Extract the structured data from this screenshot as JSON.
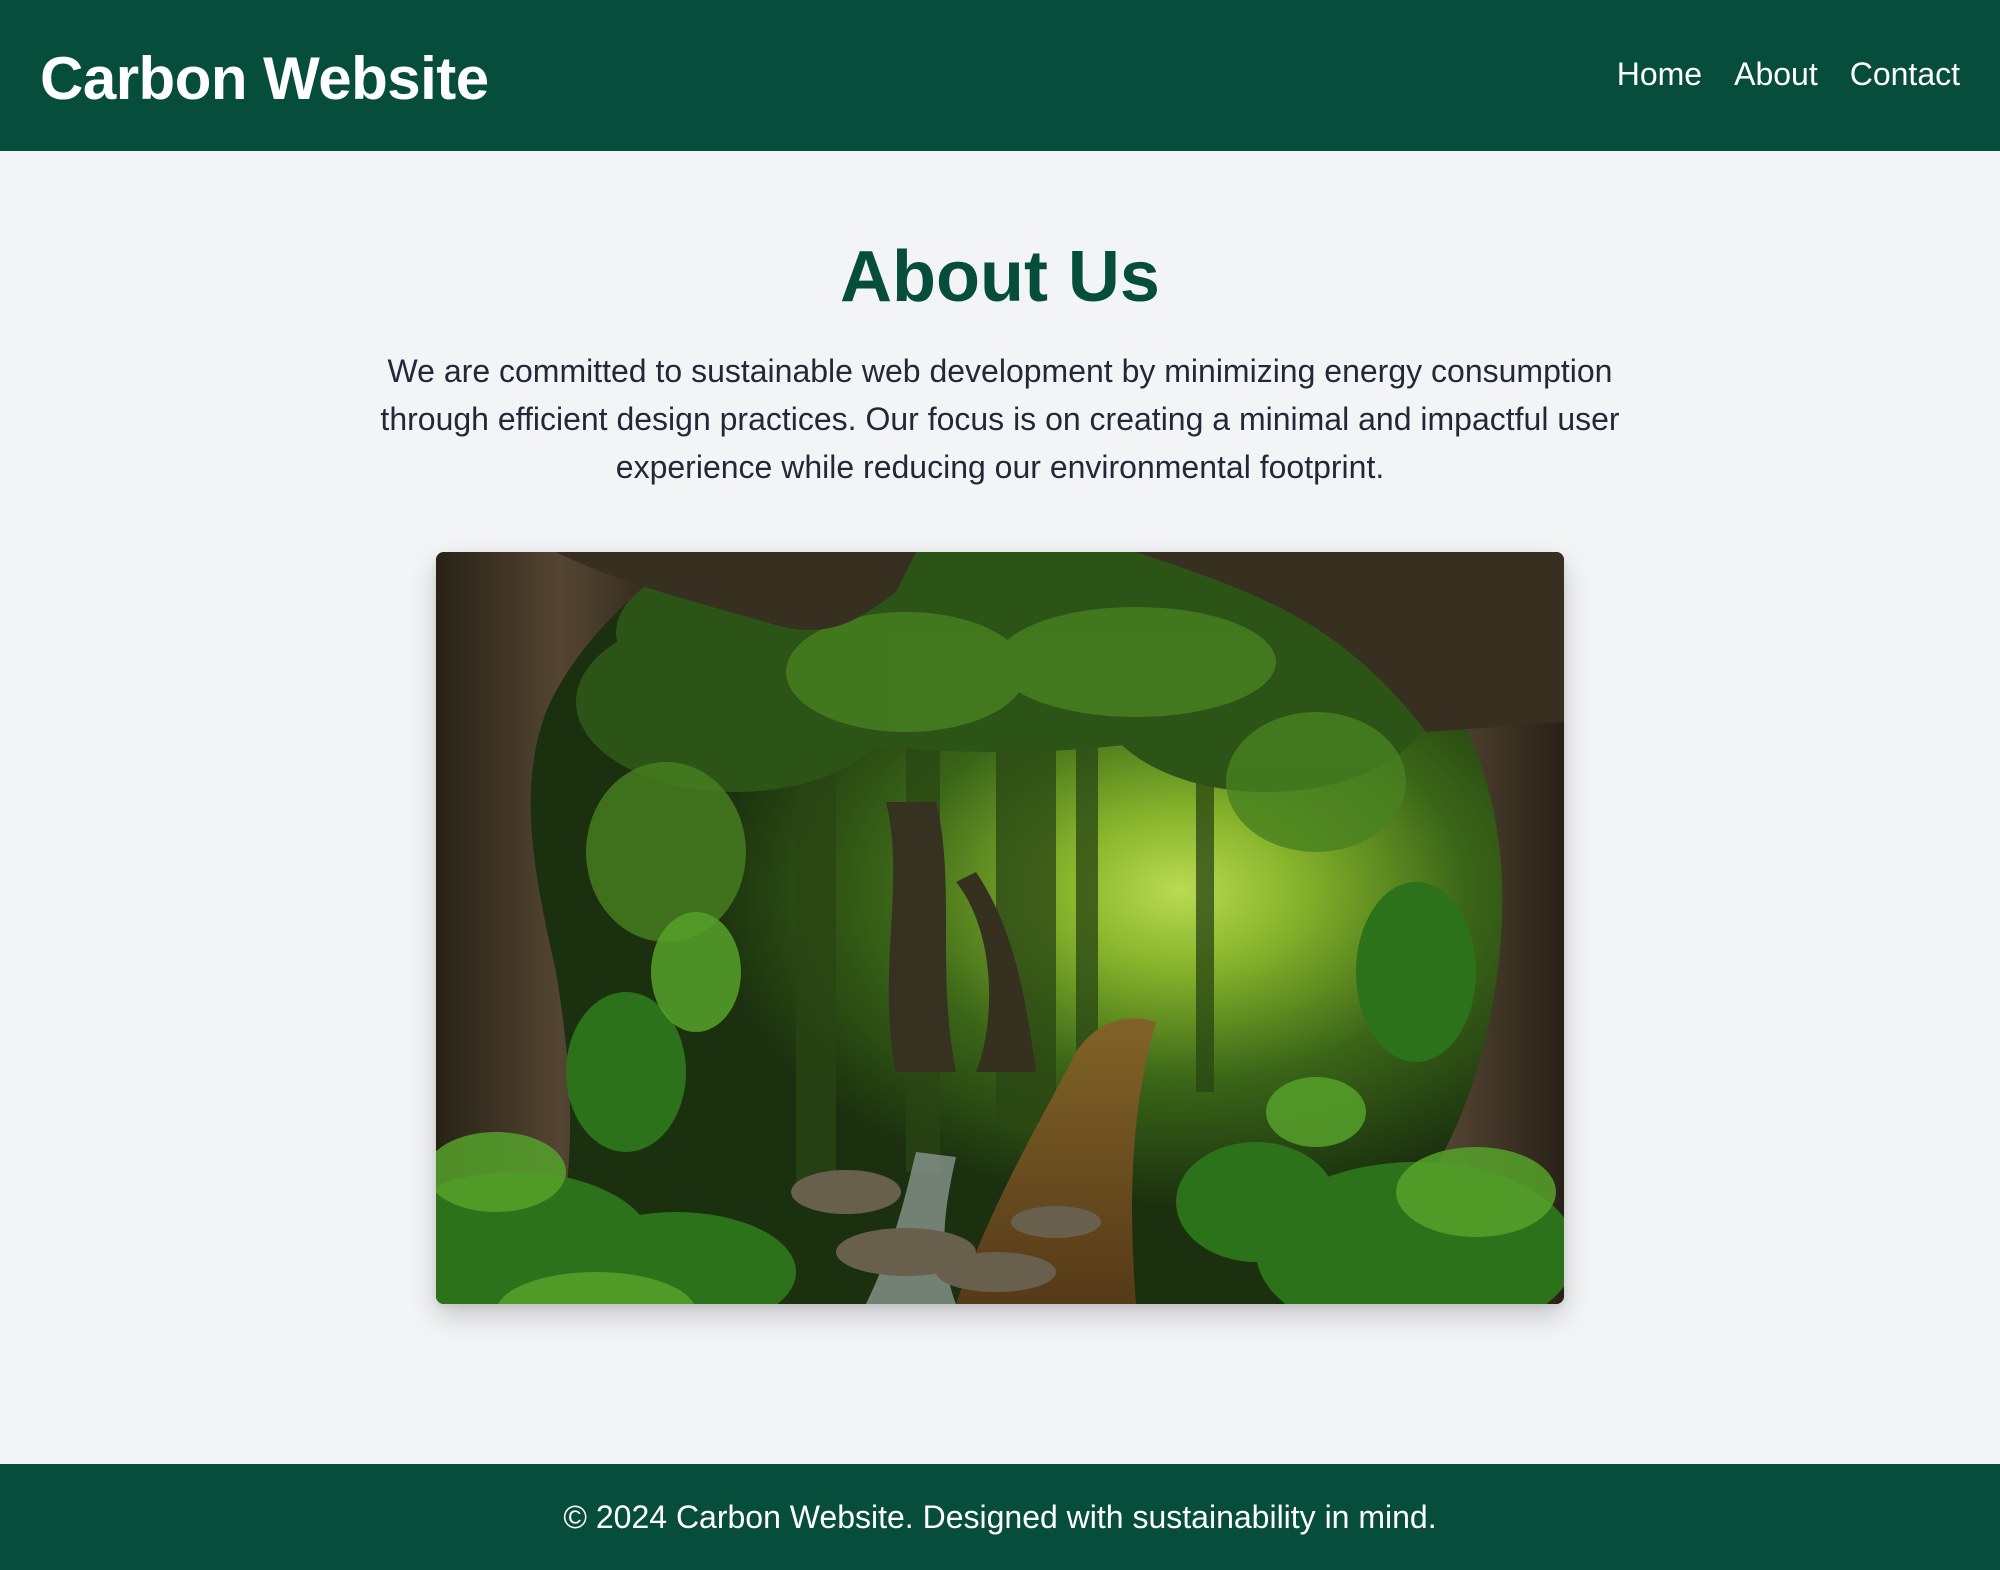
{
  "header": {
    "brand": "Carbon Website",
    "nav": [
      {
        "label": "Home"
      },
      {
        "label": "About"
      },
      {
        "label": "Contact"
      }
    ]
  },
  "main": {
    "title": "About Us",
    "intro": "We are committed to sustainable web development by minimizing energy consumption through efficient design practices. Our focus is on creating a minimal and impactful user experience while reducing our environmental footprint.",
    "image": {
      "alt": "Lush green forest path framed by large twisting tree trunks"
    }
  },
  "footer": {
    "text": "© 2024 Carbon Website. Designed with sustainability in mind."
  },
  "colors": {
    "brand_green": "#064e3b",
    "page_background": "#f3f4f6",
    "body_text": "#1f2937"
  }
}
